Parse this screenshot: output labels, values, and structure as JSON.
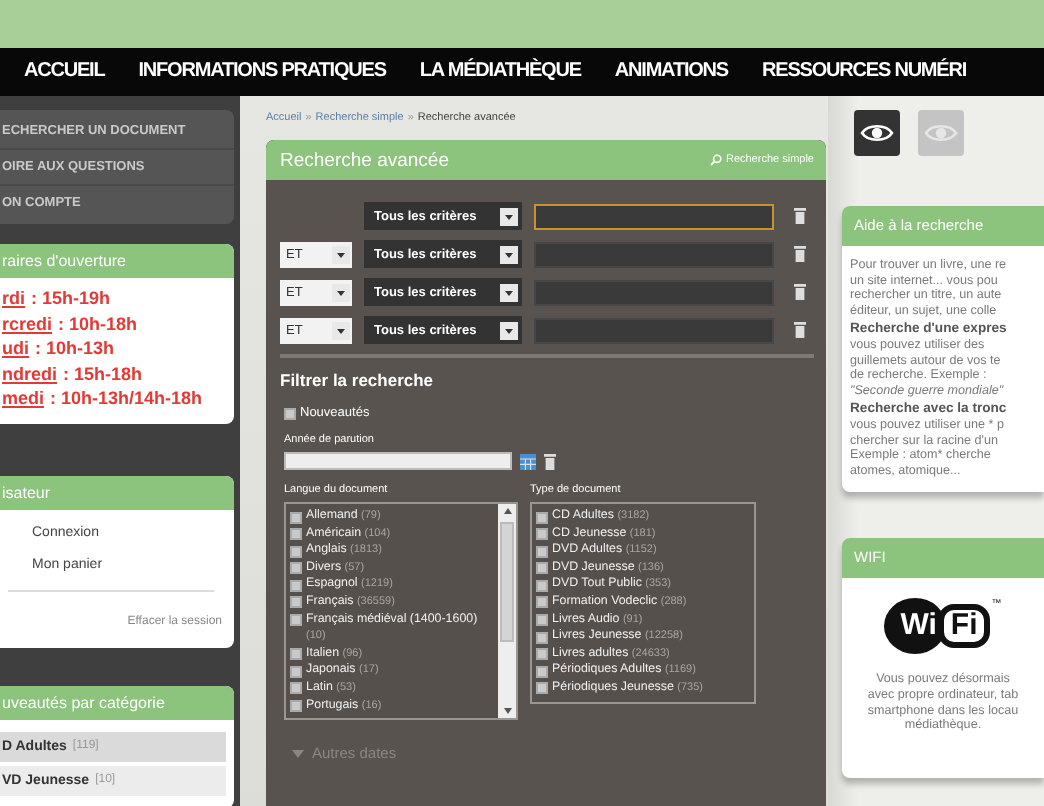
{
  "header": {
    "nav": [
      {
        "label": "ACCUEIL"
      },
      {
        "label": "INFORMATIONS PRATIQUES"
      },
      {
        "label": "LA MÉDIATHÈQUE"
      },
      {
        "label": "ANIMATIONS"
      },
      {
        "label": "RESSOURCES NUMÉRI"
      }
    ]
  },
  "sidebar": {
    "menu": [
      "ECHERCHER UN DOCUMENT",
      "OIRE AUX QUESTIONS",
      "ON COMPTE"
    ],
    "hours": {
      "title": "raires d'ouverture",
      "lines": [
        {
          "day": "rdi",
          "time": ": 15h-19h"
        },
        {
          "day": "rcredi",
          "time": ": 10h-18h"
        },
        {
          "day": "udi",
          "time": ": 10h-13h"
        },
        {
          "day": "ndredi",
          "time": ": 15h-18h"
        },
        {
          "day": "medi",
          "time": ": 10h-13h/14h-18h"
        }
      ]
    },
    "user": {
      "title": "isateur",
      "links": [
        "Connexion",
        "Mon panier"
      ],
      "clear": "Effacer la session"
    },
    "news": {
      "title": "uveautés par catégorie",
      "items": [
        {
          "name": "D Adultes",
          "count": "[119]",
          "selected": true
        },
        {
          "name": "VD Jeunesse",
          "count": "[10]",
          "selected": false
        }
      ]
    }
  },
  "search": {
    "breadcrumb": [
      {
        "text": "Accueil",
        "kind": "link"
      },
      {
        "text": "»",
        "kind": "separator"
      },
      {
        "text": "Recherche simple",
        "kind": "link"
      },
      {
        "text": "»",
        "kind": "separator"
      },
      {
        "text": "Recherche avancée",
        "kind": "current"
      }
    ],
    "title": "Recherche avancée",
    "simple_link": "Recherche simple",
    "rows": [
      {
        "criteria": "Tous les critères",
        "focused": true
      },
      {
        "operator": "ET",
        "criteria": "Tous les critères",
        "focused": false
      },
      {
        "operator": "ET",
        "criteria": "Tous les critères",
        "focused": false
      },
      {
        "operator": "ET",
        "criteria": "Tous les critères",
        "focused": false
      }
    ],
    "filter_title": "Filtrer la recherche",
    "new_only": {
      "label": "Nouveautés",
      "checked": false
    },
    "year_label": "Année de parution",
    "languages": {
      "label": "Langue du document",
      "items": [
        {
          "name": "Allemand",
          "count": "(79)",
          "checked": false
        },
        {
          "name": "Américain",
          "count": "(104)",
          "checked": false
        },
        {
          "name": "Anglais",
          "count": "(1813)",
          "checked": false
        },
        {
          "name": "Divers",
          "count": "(57)",
          "checked": false
        },
        {
          "name": "Espagnol",
          "count": "(1219)",
          "checked": false
        },
        {
          "name": "Français",
          "count": "(36559)",
          "checked": false
        },
        {
          "name": "Français médiéval (1400-1600)",
          "count": "(10)",
          "checked": false
        },
        {
          "name": "Italien",
          "count": "(96)",
          "checked": false
        },
        {
          "name": "Japonais",
          "count": "(17)",
          "checked": false
        },
        {
          "name": "Latin",
          "count": "(53)",
          "checked": false
        },
        {
          "name": "Portugais",
          "count": "(16)",
          "checked": false
        }
      ]
    },
    "types": {
      "label": "Type de document",
      "items": [
        {
          "name": "CD Adultes",
          "count": "(3182)",
          "checked": false
        },
        {
          "name": "CD Jeunesse",
          "count": "(181)",
          "checked": false
        },
        {
          "name": "DVD Adultes",
          "count": "(1152)",
          "checked": false
        },
        {
          "name": "DVD Jeunesse",
          "count": "(136)",
          "checked": false
        },
        {
          "name": "DVD Tout Public",
          "count": "(353)",
          "checked": false
        },
        {
          "name": "Formation Vodeclic",
          "count": "(288)",
          "checked": false
        },
        {
          "name": "Livres Audio",
          "count": "(91)",
          "checked": false
        },
        {
          "name": "Livres Jeunesse",
          "count": "(12258)",
          "checked": false
        },
        {
          "name": "Livres adultes",
          "count": "(24633)",
          "checked": false
        },
        {
          "name": "Périodiques Adultes",
          "count": "(1169)",
          "checked": false
        },
        {
          "name": "Périodiques Jeunesse",
          "count": "(735)",
          "checked": false
        }
      ]
    },
    "more_dates": "Autres dates"
  },
  "right": {
    "eye_toggles": [
      {
        "selected": true
      },
      {
        "selected": false
      }
    ],
    "help": {
      "title": "Aide à la recherche",
      "lines": [
        {
          "text": "Pour trouver un livre, une re",
          "kind": "plain"
        },
        {
          "text": "un site internet... vous pou",
          "kind": "plain"
        },
        {
          "text": "rechercher un titre, un aute",
          "kind": "plain"
        },
        {
          "text": "éditeur, un sujet, une colle",
          "kind": "plain"
        },
        {
          "text": "Recherche d'une expres",
          "kind": "heading"
        },
        {
          "text": "vous pouvez utiliser  des",
          "kind": "plain"
        },
        {
          "text": "guillemets autour de vos te",
          "kind": "plain"
        },
        {
          "text": "de recherche. Exemple :",
          "kind": "plain"
        },
        {
          "text": "\"Seconde guerre mondiale\"",
          "kind": "italic"
        },
        {
          "text": "Recherche avec la tronc",
          "kind": "heading"
        },
        {
          "text": "vous pouvez utiliser une * p",
          "kind": "plain"
        },
        {
          "text": "chercher sur la racine d'un",
          "kind": "plain"
        },
        {
          "text": "Exemple : atom* cherche",
          "kind": "plain"
        },
        {
          "text": "atomes, atomique...",
          "kind": "plain"
        }
      ]
    },
    "wifi": {
      "title": "WIFI",
      "logo_left": "Wi",
      "logo_right": "Fi",
      "trademark": "™",
      "lines": [
        "Vous pouvez désormais",
        "avec propre ordinateur, tab",
        "smartphone dans les locau",
        "médiathèque."
      ]
    }
  }
}
